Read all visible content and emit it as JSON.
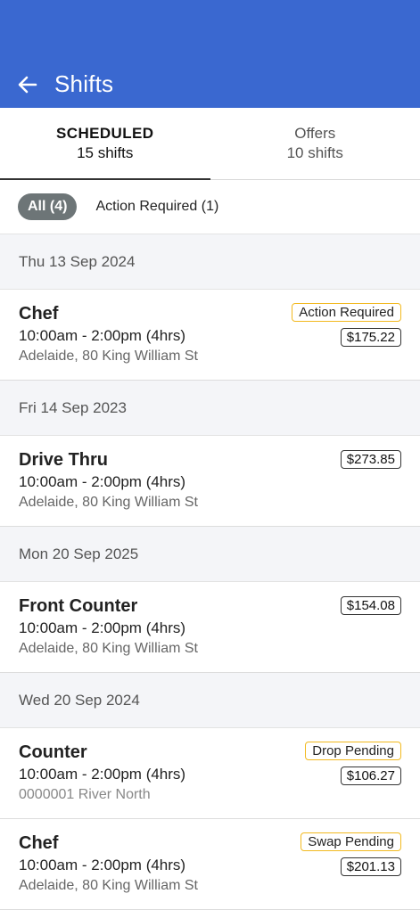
{
  "header": {
    "title": "Shifts",
    "back_icon": "arrow-left-icon",
    "color": "#3a68d0"
  },
  "tabs": [
    {
      "label": "SCHEDULED",
      "sub": "15 shifts",
      "active": true
    },
    {
      "label": "Offers",
      "sub": "10 shifts",
      "active": false
    }
  ],
  "filters": {
    "all": "All (4)",
    "action_required": "Action Required (1)"
  },
  "groups": [
    {
      "date": "Thu 13 Sep 2024",
      "shifts": [
        {
          "role": "Chef",
          "time": "10:00am - 2:00pm (4hrs)",
          "location": "Adelaide, 80 King William St",
          "badge": "Action Required",
          "price": "$175.22"
        }
      ]
    },
    {
      "date": "Fri 14 Sep 2023",
      "shifts": [
        {
          "role": "Drive Thru",
          "time": "10:00am - 2:00pm (4hrs)",
          "location": "Adelaide, 80 King William St",
          "price": "$273.85"
        }
      ]
    },
    {
      "date": "Mon 20 Sep 2025",
      "shifts": [
        {
          "role": "Front Counter",
          "time": "10:00am - 2:00pm (4hrs)",
          "location": "Adelaide, 80 King William St",
          "price": "$154.08"
        }
      ]
    },
    {
      "date": "Wed 20 Sep 2024",
      "shifts": [
        {
          "role": "Counter",
          "time": "10:00am - 2:00pm (4hrs)",
          "location": "0000001 River North",
          "badge": "Drop Pending",
          "price": "$106.27"
        },
        {
          "role": "Chef",
          "time": "10:00am - 2:00pm (4hrs)",
          "location": "Adelaide, 80 King William St",
          "badge": "Swap Pending",
          "price": "$201.13"
        }
      ]
    }
  ]
}
